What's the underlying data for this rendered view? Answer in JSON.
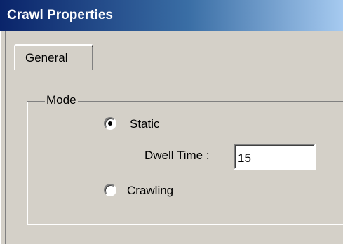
{
  "window": {
    "title": "Crawl Properties"
  },
  "tabs": [
    {
      "label": "General",
      "selected": true
    }
  ],
  "mode_group": {
    "label": "Mode",
    "options": [
      {
        "label": "Static",
        "selected": true
      },
      {
        "label": "Crawling",
        "selected": false
      }
    ],
    "dwell_time": {
      "label": "Dwell Time :",
      "value": "15"
    }
  },
  "colors": {
    "titlebar_start": "#0a246a",
    "titlebar_end": "#a6caf0",
    "face": "#d4d0c8"
  }
}
